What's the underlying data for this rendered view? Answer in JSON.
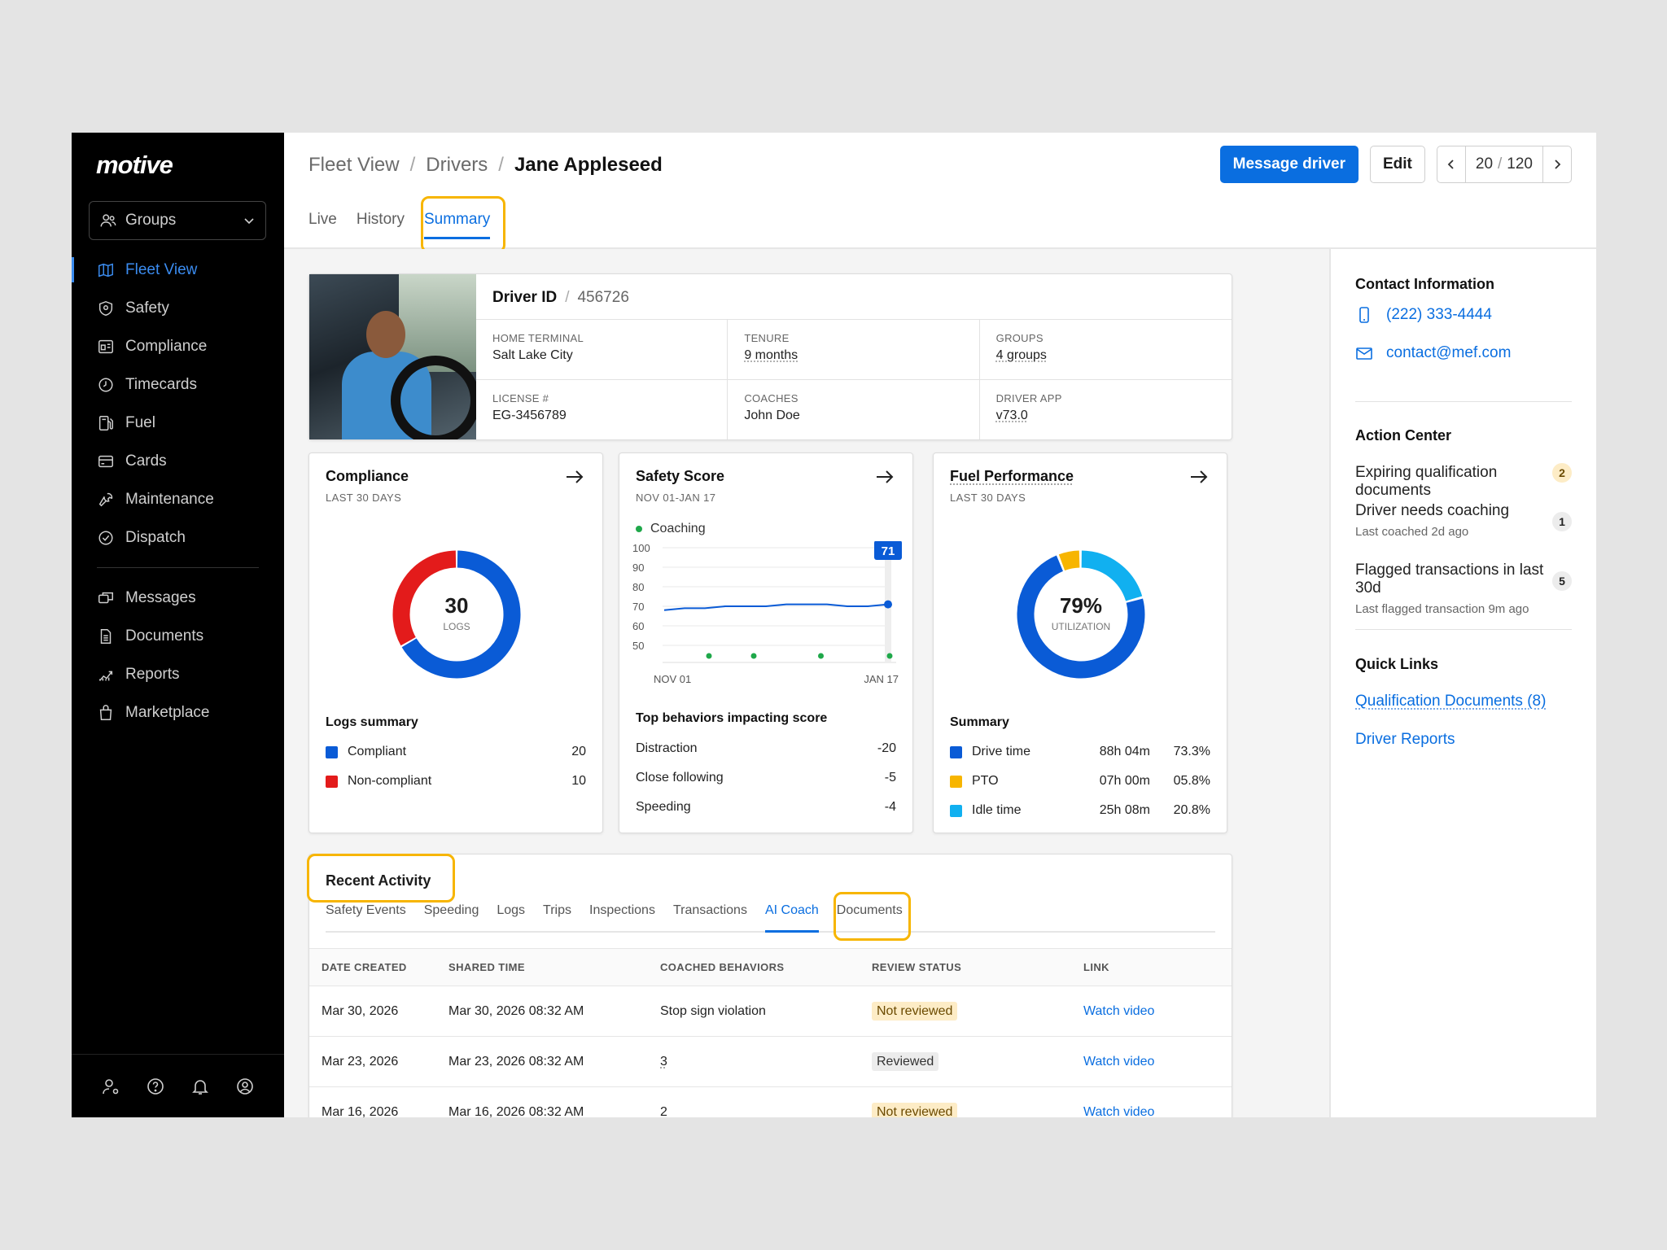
{
  "brand": "motive",
  "sidebar": {
    "groups_label": "Groups",
    "items": [
      {
        "label": "Fleet View",
        "icon": "map-icon"
      },
      {
        "label": "Safety",
        "icon": "shield-icon"
      },
      {
        "label": "Compliance",
        "icon": "compliance-icon"
      },
      {
        "label": "Timecards",
        "icon": "clock-icon"
      },
      {
        "label": "Fuel",
        "icon": "fuel-icon"
      },
      {
        "label": "Cards",
        "icon": "card-icon"
      },
      {
        "label": "Maintenance",
        "icon": "wrench-icon"
      },
      {
        "label": "Dispatch",
        "icon": "dispatch-icon"
      }
    ],
    "items2": [
      {
        "label": "Messages",
        "icon": "messages-icon"
      },
      {
        "label": "Documents",
        "icon": "document-icon"
      },
      {
        "label": "Reports",
        "icon": "reports-icon"
      },
      {
        "label": "Marketplace",
        "icon": "bag-icon"
      }
    ]
  },
  "header": {
    "crumb1": "Fleet View",
    "crumb2": "Drivers",
    "crumb3": "Jane Appleseed",
    "message_btn": "Message driver",
    "edit_btn": "Edit",
    "page_current": "20",
    "page_total": "120",
    "page_sep": "/",
    "tabs": [
      "Live",
      "History",
      "Summary"
    ]
  },
  "driver": {
    "id_label": "Driver ID",
    "id_value": "456726",
    "fields": [
      {
        "label": "HOME TERMINAL",
        "value": "Salt Lake City"
      },
      {
        "label": "TENURE",
        "value": "9 months"
      },
      {
        "label": "GROUPS",
        "value": "4 groups"
      },
      {
        "label": "LICENSE #",
        "value": "EG-3456789"
      },
      {
        "label": "COACHES",
        "value": "John Doe"
      },
      {
        "label": "DRIVER APP",
        "value": "v73.0"
      }
    ]
  },
  "compliance": {
    "title": "Compliance",
    "sub": "LAST 30 DAYS",
    "center_value": "30",
    "center_label": "LOGS",
    "summary_title": "Logs summary",
    "rows": [
      {
        "label": "Compliant",
        "value": "20",
        "color": "#0a5bd6"
      },
      {
        "label": "Non-compliant",
        "value": "10",
        "color": "#e31b1b"
      }
    ]
  },
  "safety": {
    "title": "Safety Score",
    "sub": "NOV 01-JAN 17",
    "legend": "Coaching",
    "score_badge": "71",
    "x_start": "NOV 01",
    "x_end": "JAN 17",
    "behaviors_title": "Top behaviors impacting score",
    "behaviors": [
      {
        "label": "Distraction",
        "value": "-20"
      },
      {
        "label": "Close following",
        "value": "-5"
      },
      {
        "label": "Speeding",
        "value": "-4"
      }
    ]
  },
  "fuel": {
    "title": "Fuel Performance",
    "sub": "LAST 30 DAYS",
    "center_value": "79%",
    "center_label": "UTILIZATION",
    "summary_title": "Summary",
    "rows": [
      {
        "label": "Drive time",
        "time": "88h 04m",
        "pct": "73.3%",
        "color": "#0a5bd6"
      },
      {
        "label": "PTO",
        "time": "07h 00m",
        "pct": "05.8%",
        "color": "#f7b500"
      },
      {
        "label": "Idle time",
        "time": "25h 08m",
        "pct": "20.8%",
        "color": "#11b0f0"
      }
    ]
  },
  "chart_data": [
    {
      "type": "pie",
      "title": "Compliance",
      "categories": [
        "Compliant",
        "Non-compliant"
      ],
      "values": [
        20,
        10
      ]
    },
    {
      "type": "line",
      "title": "Safety Score",
      "ylim": [
        50,
        100
      ],
      "y_ticks": [
        100,
        90,
        80,
        70,
        60,
        50
      ],
      "x_labels": [
        "NOV 01",
        "JAN 17"
      ],
      "series": [
        {
          "name": "Safety Score",
          "values": [
            68,
            69,
            69,
            70,
            70,
            70,
            71,
            71,
            71,
            70,
            70,
            71
          ]
        }
      ],
      "coaching_points": [
        0.2,
        0.4,
        0.7,
        1.0
      ]
    },
    {
      "type": "pie",
      "title": "Fuel Performance",
      "categories": [
        "Drive time",
        "PTO",
        "Idle time"
      ],
      "values": [
        73.3,
        5.8,
        20.8
      ]
    }
  ],
  "recent": {
    "title": "Recent Activity",
    "tabs": [
      "Safety Events",
      "Speeding",
      "Logs",
      "Trips",
      "Inspections",
      "Transactions",
      "AI Coach",
      "Documents"
    ],
    "columns": [
      "DATE CREATED",
      "SHARED TIME",
      "COACHED BEHAVIORS",
      "REVIEW STATUS",
      "LINK"
    ],
    "rows": [
      {
        "date": "Mar 30, 2026",
        "shared": "Mar 30, 2026 08:32 AM",
        "behaviors": "Stop sign violation",
        "status": "Not reviewed",
        "link": "Watch video"
      },
      {
        "date": "Mar 23, 2026",
        "shared": "Mar 23, 2026 08:32 AM",
        "behaviors": "3",
        "status": "Reviewed",
        "link": "Watch video"
      },
      {
        "date": "Mar 16, 2026",
        "shared": "Mar 16, 2026 08:32 AM",
        "behaviors": "2",
        "status": "Not reviewed",
        "link": "Watch video"
      }
    ]
  },
  "right": {
    "contact_title": "Contact Information",
    "phone": "(222) 333-4444",
    "email": "contact@mef.com",
    "action_title": "Action Center",
    "actions": [
      {
        "main": "Expiring qualification documents",
        "sub": "",
        "count": "2"
      },
      {
        "main": "Driver needs coaching",
        "sub": "Last coached 2d ago",
        "count": "1"
      },
      {
        "main": "Flagged transactions in last 30d",
        "sub": "Last flagged transaction 9m ago",
        "count": "5"
      }
    ],
    "quick_title": "Quick Links",
    "links": [
      "Qualification Documents (8)",
      "Driver Reports"
    ]
  },
  "colors": {
    "accent": "#0a6ee0",
    "highlight": "#f7b500",
    "sidebar_bg": "#000000"
  }
}
